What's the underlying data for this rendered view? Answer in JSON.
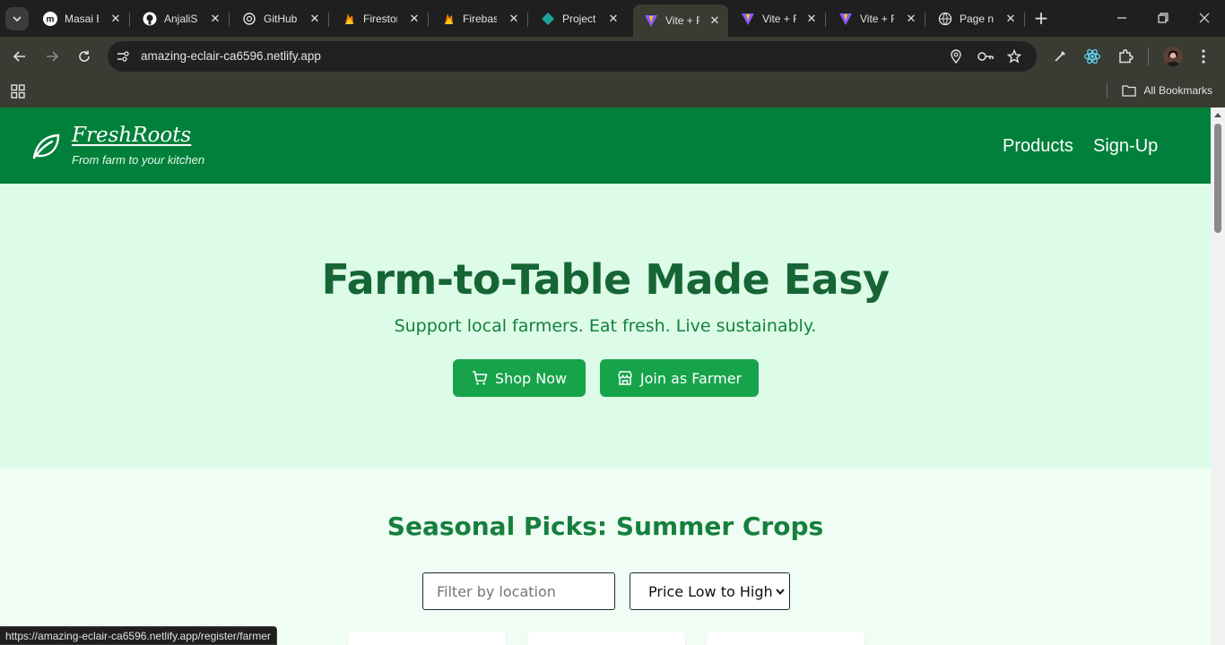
{
  "browser": {
    "tabs": [
      {
        "label": "Masai E",
        "icon": "masai-icon"
      },
      {
        "label": "AnjaliSh",
        "icon": "github-icon"
      },
      {
        "label": "GitHub",
        "icon": "openai-icon"
      },
      {
        "label": "Firestor",
        "icon": "firebase-icon"
      },
      {
        "label": "Firebase",
        "icon": "firebase-icon"
      },
      {
        "label": "Project",
        "icon": "diamond-icon"
      },
      {
        "label": "Vite + R",
        "icon": "vite-icon",
        "active": true
      },
      {
        "label": "Vite + R",
        "icon": "vite-icon"
      },
      {
        "label": "Vite + R",
        "icon": "vite-icon"
      },
      {
        "label": "Page no",
        "icon": "globe-icon"
      }
    ],
    "tab_close": "✕",
    "new_tab": "+",
    "address": "amazing-eclair-ca6596.netlify.app",
    "all_bookmarks": "All Bookmarks",
    "status_url": "https://amazing-eclair-ca6596.netlify.app/register/farmer"
  },
  "site": {
    "brand": {
      "name": "FreshRoots",
      "tagline": "From farm to your kitchen"
    },
    "nav": {
      "products": "Products",
      "signup": "Sign-Up"
    },
    "hero": {
      "title": "Farm-to-Table Made Easy",
      "subtitle": "Support local farmers. Eat fresh. Live sustainably.",
      "shop_button": "Shop Now",
      "farmer_button": "Join as Farmer"
    },
    "seasonal": {
      "title": "Seasonal Picks: Summer Crops",
      "filter_placeholder": "Filter by location",
      "sort_selected": "Price Low to High"
    }
  },
  "colors": {
    "header_green": "#00803a",
    "hero_bg": "#dcfce7",
    "button_green": "#16a34a",
    "title_green": "#166534"
  }
}
